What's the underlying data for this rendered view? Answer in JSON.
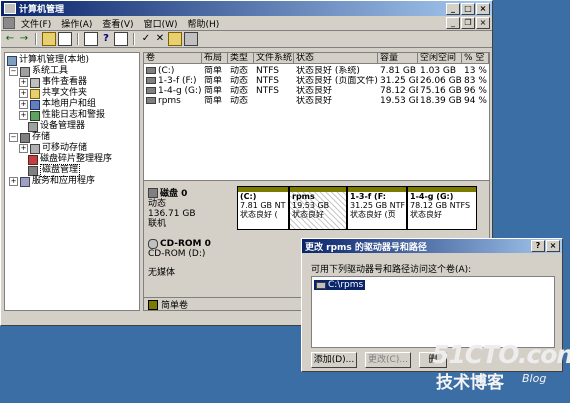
{
  "window": {
    "title": "计算机管理",
    "menu": [
      "文件(F)",
      "操作(A)",
      "查看(V)",
      "窗口(W)",
      "帮助(H)"
    ],
    "controls": {
      "minimize": "_",
      "maximize": "□",
      "close": "×",
      "restore": "❐"
    }
  },
  "tree": {
    "root": "计算机管理(本地)",
    "system_tools": "系统工具",
    "event_viewer": "事件查看器",
    "shared_folders": "共享文件夹",
    "local_users": "本地用户和组",
    "perf_logs": "性能日志和警报",
    "device_manager": "设备管理器",
    "storage": "存储",
    "removable": "可移动存储",
    "defrag": "磁盘碎片整理程序",
    "disk_mgmt": "磁盘管理",
    "services": "服务和应用程序"
  },
  "volume_table": {
    "headers": [
      "卷",
      "布局",
      "类型",
      "文件系统",
      "状态",
      "容量",
      "空闲空间",
      "% 空"
    ],
    "rows": [
      [
        "(C:)",
        "简单",
        "动态",
        "NTFS",
        "状态良好 (系统)",
        "7.81 GB",
        "1.03 GB",
        "13 %"
      ],
      [
        "1-3-f (F:)",
        "简单",
        "动态",
        "NTFS",
        "状态良好 (页面文件)",
        "31.25 GB",
        "26.06 GB",
        "83 %"
      ],
      [
        "1-4-g (G:)",
        "简单",
        "动态",
        "NTFS",
        "状态良好",
        "78.12 GB",
        "75.16 GB",
        "96 %"
      ],
      [
        "rpms",
        "简单",
        "动态",
        "",
        "状态良好",
        "19.53 GB",
        "18.39 GB",
        "94 %"
      ]
    ]
  },
  "disk0": {
    "name": "磁盘 0",
    "type": "动态",
    "size": "136.71 GB",
    "state": "联机",
    "partitions": [
      {
        "name": "(C:)",
        "size": "7.81 GB NT",
        "status": "状态良好 ("
      },
      {
        "name": "rpms",
        "size": "19.53 GB",
        "status": "状态良好"
      },
      {
        "name": "1-3-f (F:",
        "size": "31.25 GB NTF",
        "status": "状态良好 (页"
      },
      {
        "name": "1-4-g (G:)",
        "size": "78.12 GB NTFS",
        "status": "状态良好"
      }
    ]
  },
  "cdrom": {
    "name": "CD-ROM 0",
    "sub": "CD-ROM (D:)",
    "media": "无媒体"
  },
  "legend": {
    "simple_volume": "简单卷"
  },
  "dialog": {
    "title": "更改 rpms 的驱动器号和路径",
    "help": "?",
    "close": "×",
    "prompt": "可用下列驱动器号和路径访问这个卷(A):",
    "list_item": "C:\\rpms",
    "add": "添加(D)...",
    "change": "更改(C)...",
    "remove": "删"
  },
  "watermark": {
    "line1": "51CTO.com",
    "line2": "技术博客",
    "line3": "Blog"
  }
}
